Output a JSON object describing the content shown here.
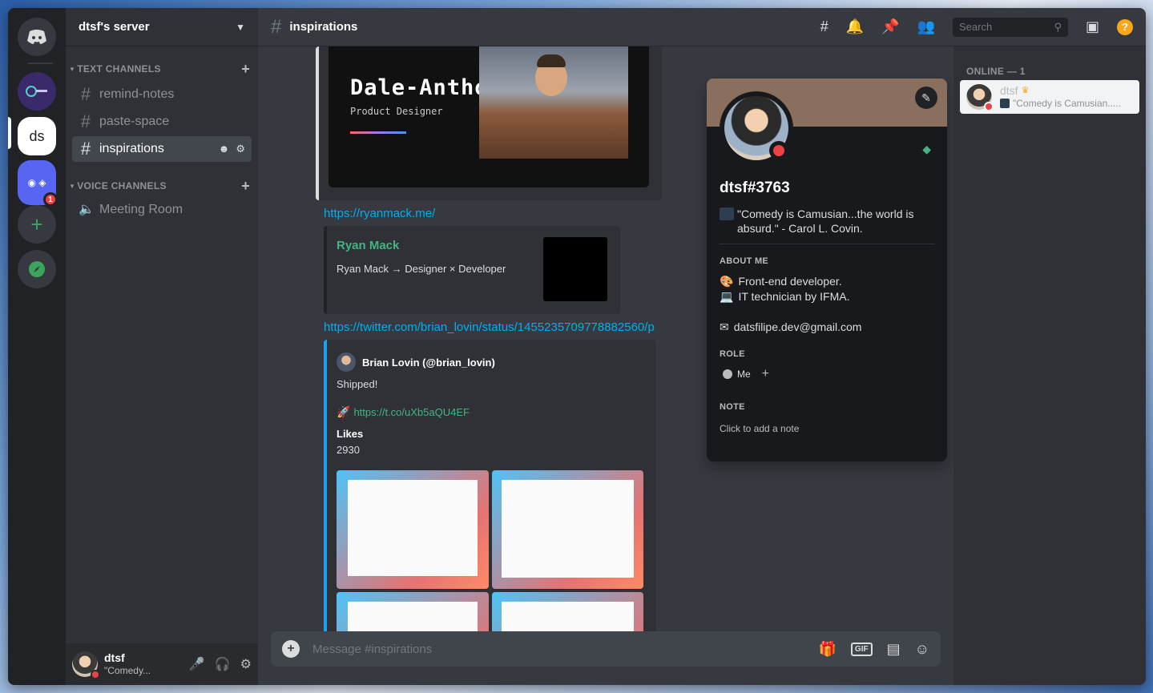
{
  "server": {
    "name": "dtsf's server",
    "rail": {
      "ds_label": "ds",
      "badge_count": "1"
    }
  },
  "channels": {
    "text_category": "TEXT CHANNELS",
    "text": [
      {
        "name": "remind-notes"
      },
      {
        "name": "paste-space"
      },
      {
        "name": "inspirations"
      }
    ],
    "voice_category": "VOICE CHANNELS",
    "voice": [
      {
        "name": "Meeting Room"
      }
    ]
  },
  "user_panel": {
    "name": "dtsf",
    "status": "\"Comedy..."
  },
  "topbar": {
    "channel": "inspirations",
    "search_placeholder": "Search"
  },
  "messages": {
    "card1": {
      "name": "Dale-Anthony",
      "role": "Product Designer"
    },
    "link1": "https://ryanmack.me/",
    "embed1": {
      "title": "Ryan Mack",
      "desc": "Ryan Mack → Designer × Developer"
    },
    "link2": "https://twitter.com/brian_lovin/status/1455235709778882560/p",
    "tweet": {
      "author": "Brian Lovin (@brian_lovin)",
      "text": "Shipped!",
      "link": "https://t.co/uXb5aQU4EF",
      "likes_label": "Likes",
      "likes_value": "2930"
    }
  },
  "composer": {
    "placeholder": "Message #inspirations"
  },
  "members": {
    "header": "ONLINE — 1",
    "list": [
      {
        "name": "dtsf",
        "status": "\"Comedy is Camusian....."
      }
    ]
  },
  "profile": {
    "tag": "dtsf#3763",
    "custom_status": "\"Comedy is Camusian...the world is absurd.\" - Carol L. Covin.",
    "about_heading": "ABOUT ME",
    "about_line1": "Front-end developer.",
    "about_line2": "IT technician by IFMA.",
    "email": "datsfilipe.dev@gmail.com",
    "role_heading": "ROLE",
    "role_name": "Me",
    "note_heading": "NOTE",
    "note_placeholder": "Click to add a note"
  },
  "colors": {
    "accent_link": "#00aff4",
    "dnd": "#ed4245",
    "profile_banner": "#8a6e5e",
    "help": "#faa61a"
  }
}
